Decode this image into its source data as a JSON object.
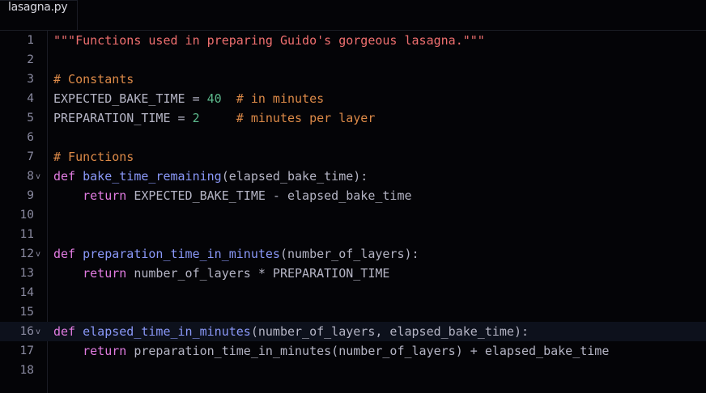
{
  "tab": {
    "title": "lasagna.py"
  },
  "colors": {
    "str": "#ef6f6f",
    "cm": "#dd8a48",
    "num": "#5cb88c",
    "kw": "#e07be0",
    "fn": "#8a98f8",
    "id": "#b4b4c4"
  },
  "highlighted_line": 16,
  "lines": [
    {
      "n": "1",
      "tokens": [
        [
          "str",
          "\"\"\"Functions used in preparing Guido's gorgeous lasagna.\"\"\""
        ]
      ]
    },
    {
      "n": "2",
      "tokens": []
    },
    {
      "n": "3",
      "tokens": [
        [
          "cm",
          "# Constants"
        ]
      ]
    },
    {
      "n": "4",
      "tokens": [
        [
          "id",
          "EXPECTED_BAKE_TIME = "
        ],
        [
          "num",
          "40"
        ],
        [
          "id",
          "  "
        ],
        [
          "cm",
          "# in minutes"
        ]
      ]
    },
    {
      "n": "5",
      "tokens": [
        [
          "id",
          "PREPARATION_TIME = "
        ],
        [
          "num",
          "2"
        ],
        [
          "id",
          "     "
        ],
        [
          "cm",
          "# minutes per layer"
        ]
      ]
    },
    {
      "n": "6",
      "tokens": []
    },
    {
      "n": "7",
      "tokens": [
        [
          "cm",
          "# Functions"
        ]
      ]
    },
    {
      "n": "8",
      "fold": "v",
      "tokens": [
        [
          "kw",
          "def "
        ],
        [
          "fn",
          "bake_time_remaining"
        ],
        [
          "id",
          "(elapsed_bake_time):"
        ]
      ]
    },
    {
      "n": "9",
      "tokens": [
        [
          "id",
          "    "
        ],
        [
          "kw",
          "return "
        ],
        [
          "id",
          "EXPECTED_BAKE_TIME - elapsed_bake_time"
        ]
      ]
    },
    {
      "n": "10",
      "tokens": []
    },
    {
      "n": "11",
      "tokens": []
    },
    {
      "n": "12",
      "fold": "v",
      "tokens": [
        [
          "kw",
          "def "
        ],
        [
          "fn",
          "preparation_time_in_minutes"
        ],
        [
          "id",
          "(number_of_layers):"
        ]
      ]
    },
    {
      "n": "13",
      "tokens": [
        [
          "id",
          "    "
        ],
        [
          "kw",
          "return "
        ],
        [
          "id",
          "number_of_layers * PREPARATION_TIME"
        ]
      ]
    },
    {
      "n": "14",
      "tokens": []
    },
    {
      "n": "15",
      "tokens": []
    },
    {
      "n": "16",
      "fold": "v",
      "tokens": [
        [
          "kw",
          "def "
        ],
        [
          "fn",
          "elapsed_time_in_minutes"
        ],
        [
          "id",
          "(number_of_layers, elapsed_bake_time):"
        ]
      ]
    },
    {
      "n": "17",
      "tokens": [
        [
          "id",
          "    "
        ],
        [
          "kw",
          "return "
        ],
        [
          "id",
          "preparation_time_in_minutes(number_of_layers) + elapsed_bake_time"
        ]
      ]
    },
    {
      "n": "18",
      "tokens": []
    }
  ]
}
